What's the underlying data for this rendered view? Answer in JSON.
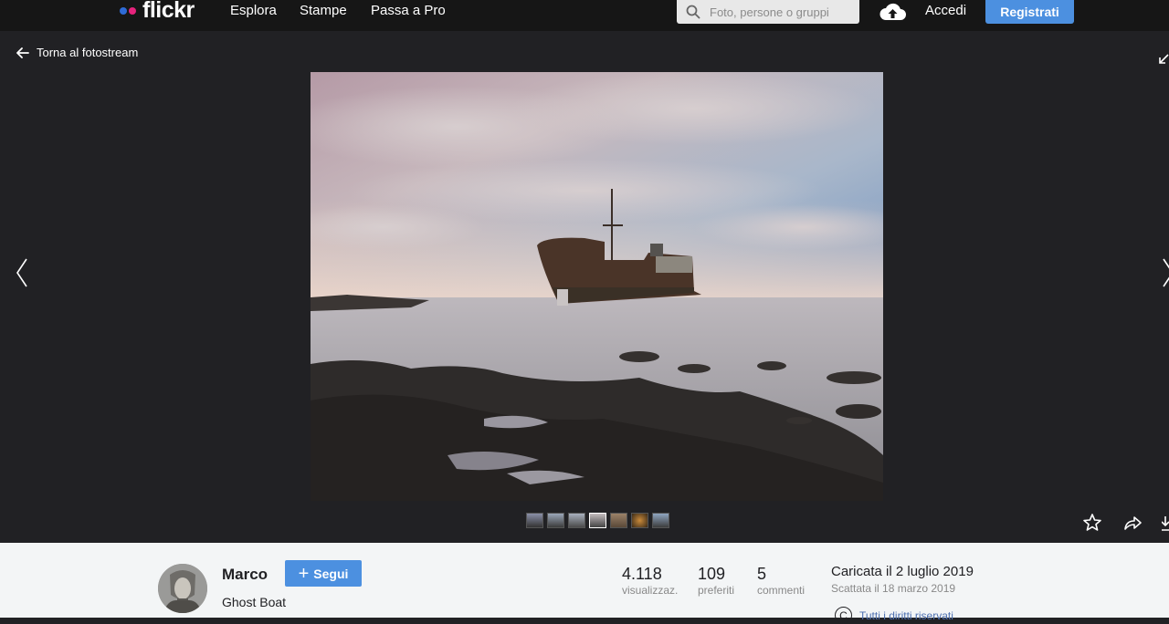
{
  "header": {
    "logo": "flickr",
    "nav": [
      "Esplora",
      "Stampe",
      "Passa a Pro"
    ],
    "search_placeholder": "Foto, persone o gruppi",
    "login": "Accedi",
    "signup": "Registrati"
  },
  "viewer": {
    "back_label": "Torna al fotostream"
  },
  "info": {
    "owner": "Marco",
    "follow_label": "Segui",
    "photo_title": "Ghost Boat",
    "stats": [
      {
        "num": "4.118",
        "label": "visualizzaz."
      },
      {
        "num": "109",
        "label": "preferiti"
      },
      {
        "num": "5",
        "label": "commenti"
      }
    ],
    "uploaded": "Caricata il 2 luglio 2019",
    "taken": "Scattata il 18 marzo 2019",
    "rights": "Tutti i diritti riservati"
  },
  "colors": {
    "accent": "#4c90e0",
    "header_bg": "#161616",
    "viewer_bg": "#212124",
    "info_bg": "#f3f5f6"
  }
}
